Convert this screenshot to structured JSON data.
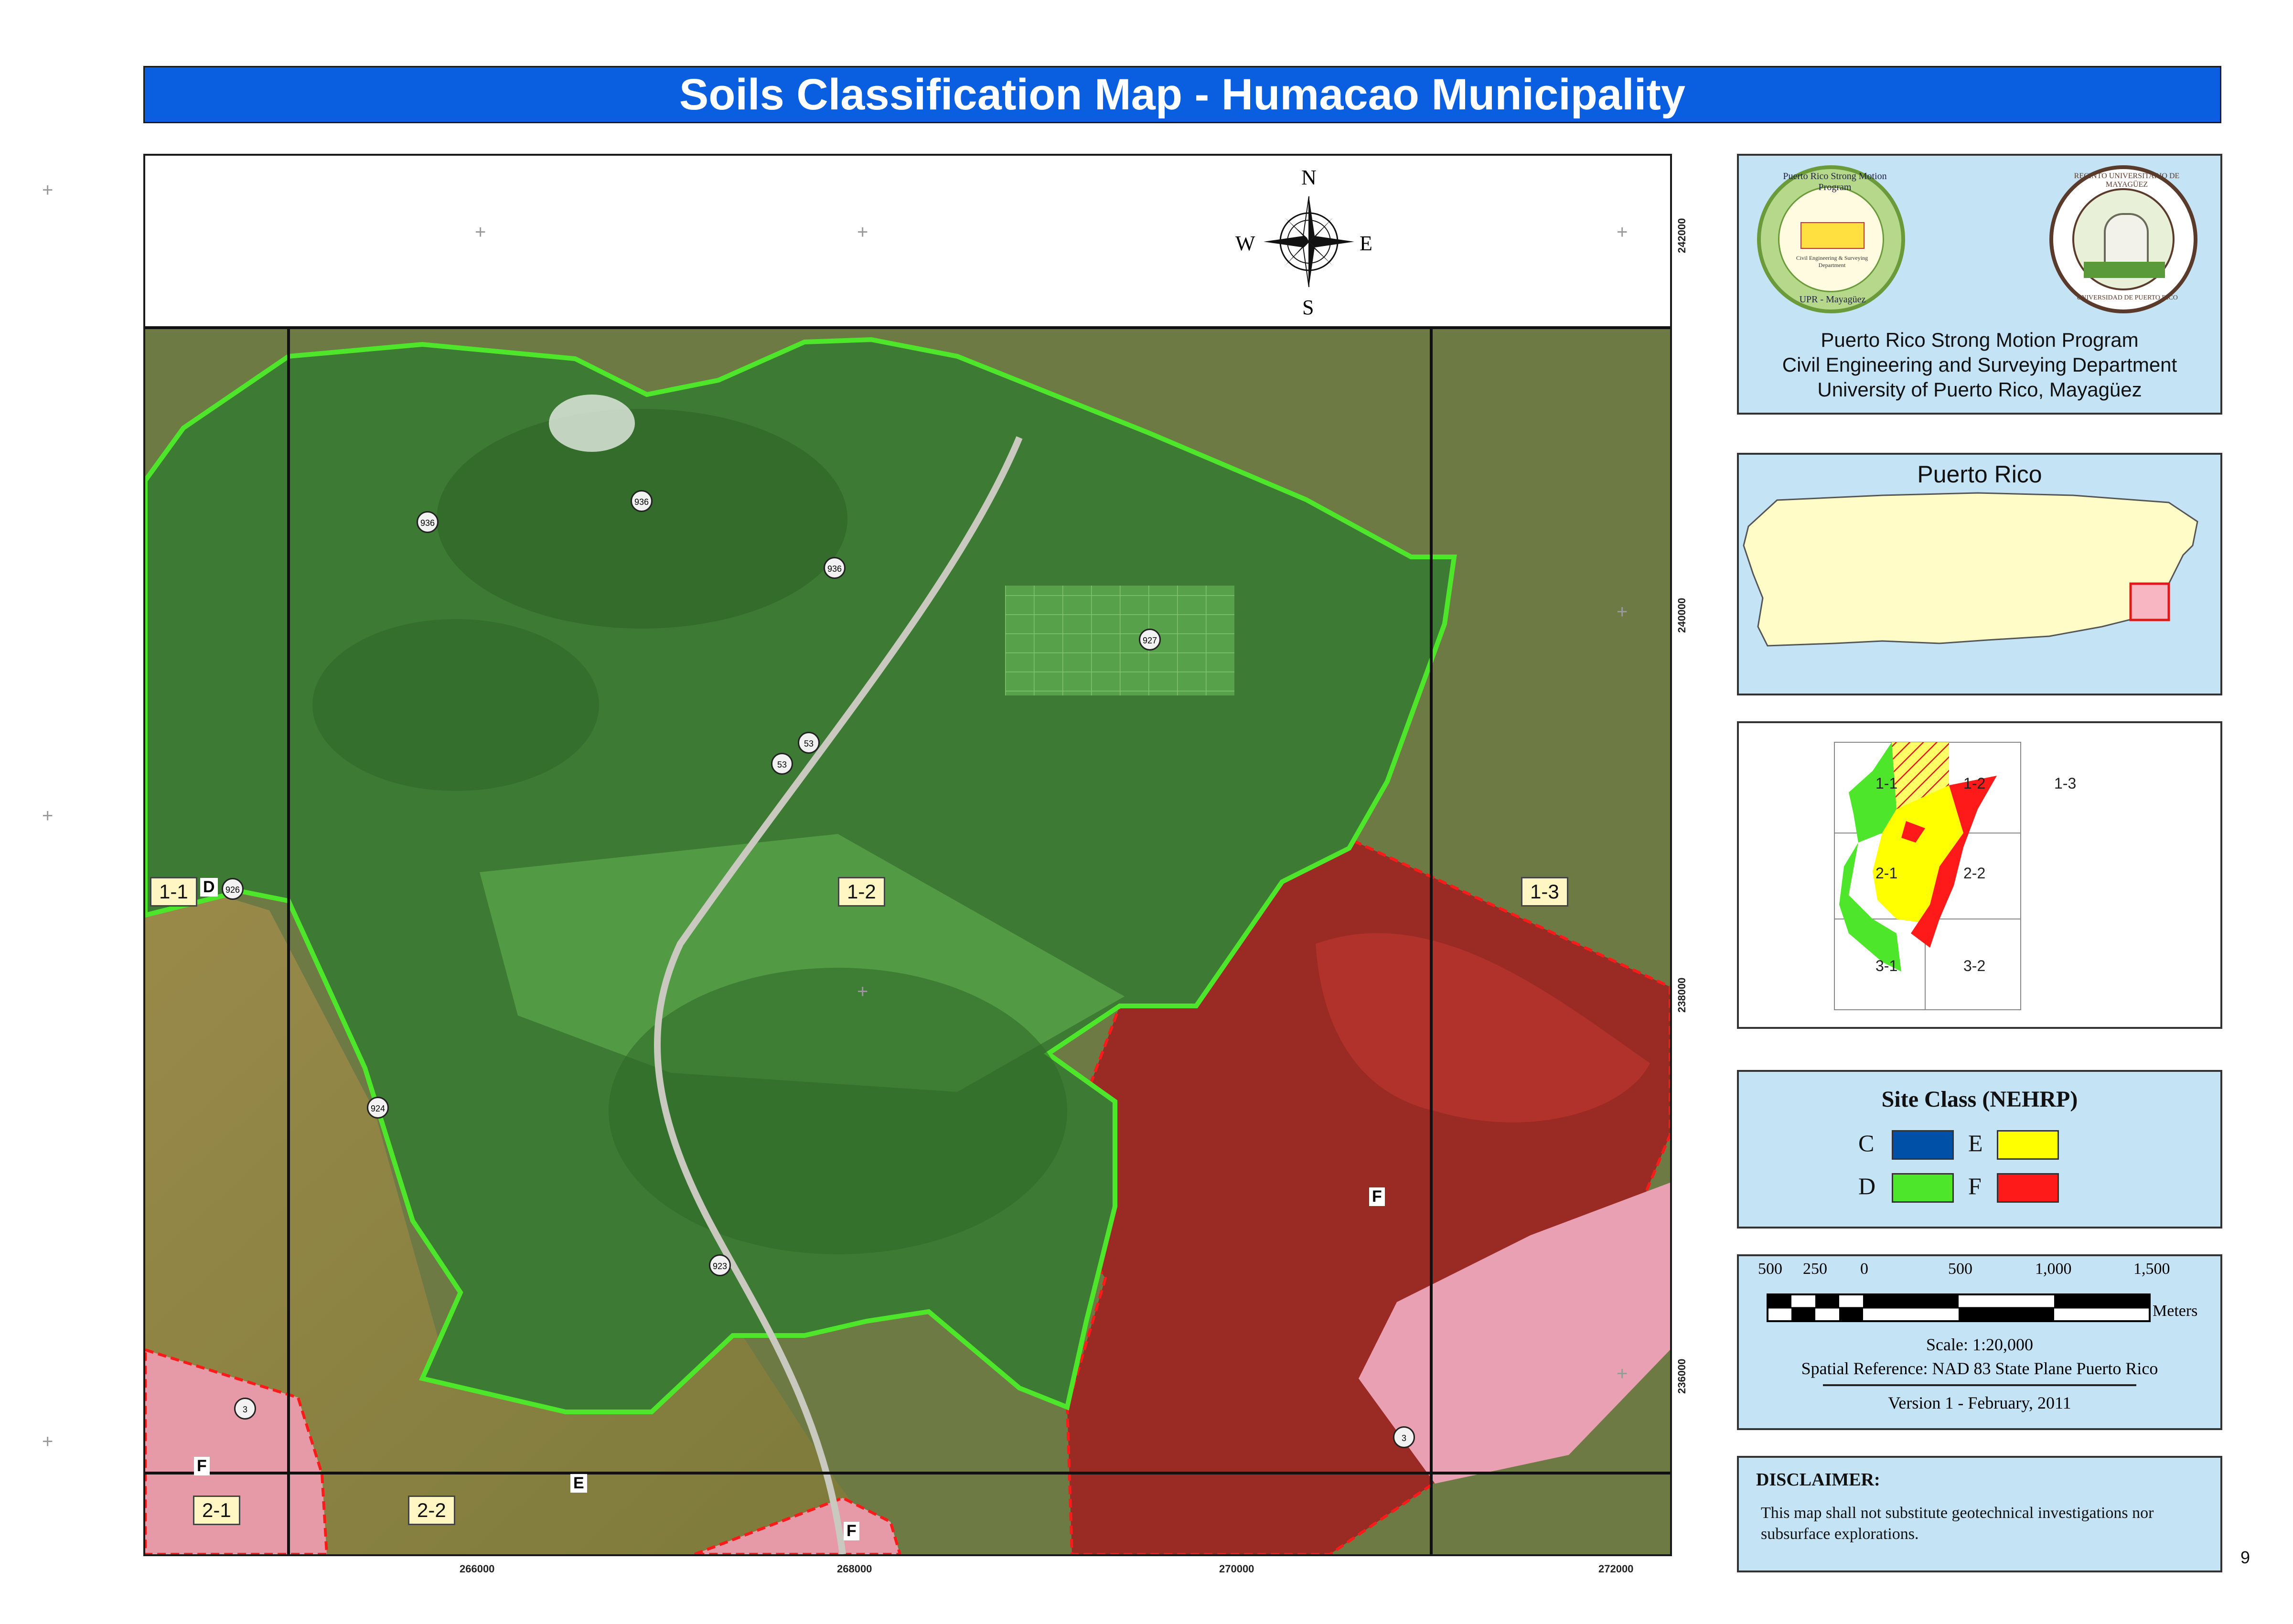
{
  "title": "Soils Classification Map - Humacao Municipality",
  "page_number": "9",
  "map": {
    "x_coords": [
      "266000",
      "268000",
      "270000",
      "272000"
    ],
    "y_coords": [
      "242000",
      "240000",
      "238000",
      "236000"
    ],
    "compass": {
      "n": "N",
      "s": "S",
      "e": "E",
      "w": "W"
    },
    "zone_labels": [
      "1-1",
      "1-2",
      "1-3",
      "2-1",
      "2-2"
    ],
    "class_markers": {
      "d": "D",
      "f_east": "F",
      "f_west": "F",
      "f_south": "F",
      "e": "E"
    },
    "roads": [
      "936",
      "936",
      "936",
      "927",
      "53",
      "53",
      "926",
      "924",
      "923",
      "3",
      "3"
    ],
    "colors": {
      "class_d": "#4ee62a",
      "class_f": "#ff1a1a",
      "class_e": "#ffff00",
      "class_c": "#0050a8"
    }
  },
  "header_panel": {
    "line1": "Puerto Rico Strong Motion Program",
    "line2": "Civil Engineering and Surveying Department",
    "line3": "University of Puerto Rico, Mayagüez",
    "logo1_ring": "Puerto Rico Strong Motion Program",
    "logo1_bottom": "UPR - Mayagüez",
    "logo1_inner": "Civil Engineering & Surveying Department",
    "logo2_ring": "RECINTO UNIVERSITARIO DE MAYAGÜEZ",
    "logo2_bottom": "UNIVERSIDAD DE PUERTO RICO"
  },
  "locator": {
    "title": "Puerto Rico"
  },
  "index_map": {
    "cells": [
      "1-1",
      "1-2",
      "1-3",
      "2-1",
      "2-2",
      "3-1",
      "3-2"
    ]
  },
  "legend": {
    "title": "Site Class (NEHRP)",
    "items": [
      {
        "label": "C",
        "color": "#0050a8"
      },
      {
        "label": "E",
        "color": "#ffff00"
      },
      {
        "label": "D",
        "color": "#4ee62a"
      },
      {
        "label": "F",
        "color": "#ff1a1a"
      }
    ]
  },
  "scale": {
    "ticks": [
      "500",
      "250",
      "0",
      "500",
      "1,000",
      "1,500"
    ],
    "unit": "Meters",
    "scale_text": "Scale:  1:20,000",
    "spatial_ref": "Spatial Reference: NAD 83 State Plane Puerto Rico",
    "version": "Version 1 - February, 2011"
  },
  "disclaimer": {
    "title": "DISCLAIMER:",
    "text": "This map shall not substitute geotechnical investigations nor subsurface explorations."
  }
}
